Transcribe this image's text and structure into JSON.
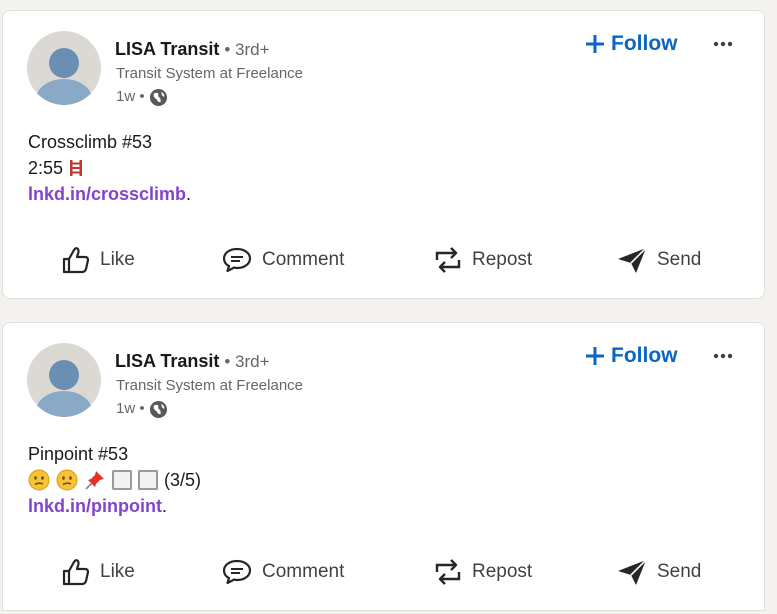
{
  "posts": [
    {
      "author": "LISA Transit",
      "degree": "• 3rd+",
      "headline": "Transit System at Freelance",
      "time": "1w •",
      "follow_label": "Follow",
      "text": {
        "line1": "Crossclimb #53",
        "line2": "2:55",
        "link": "lnkd.in/crossclimb",
        "link_suffix": "."
      },
      "actions": {
        "like": "Like",
        "comment": "Comment",
        "repost": "Repost",
        "send": "Send"
      }
    },
    {
      "author": "LISA Transit",
      "degree": "• 3rd+",
      "headline": "Transit System at Freelance",
      "time": "1w •",
      "follow_label": "Follow",
      "text": {
        "line1": "Pinpoint #53",
        "score": "(3/5)",
        "link": "lnkd.in/pinpoint",
        "link_suffix": "."
      },
      "actions": {
        "like": "Like",
        "comment": "Comment",
        "repost": "Repost",
        "send": "Send"
      }
    }
  ],
  "icons": {
    "globe": "globe-icon",
    "follow": "plus-icon",
    "more": "more-options-icon",
    "ladder": "ladder-icon",
    "confused": "confused-face-icon",
    "pin": "pushpin-icon",
    "like": "thumbs-up-icon",
    "comment": "comment-bubble-icon",
    "repost": "repost-arrows-icon",
    "send": "paper-plane-icon"
  },
  "colors": {
    "follow": "#0a66c2",
    "link": "#8344cc",
    "muted": "#666666",
    "page_bg": "#f4f2ee"
  }
}
